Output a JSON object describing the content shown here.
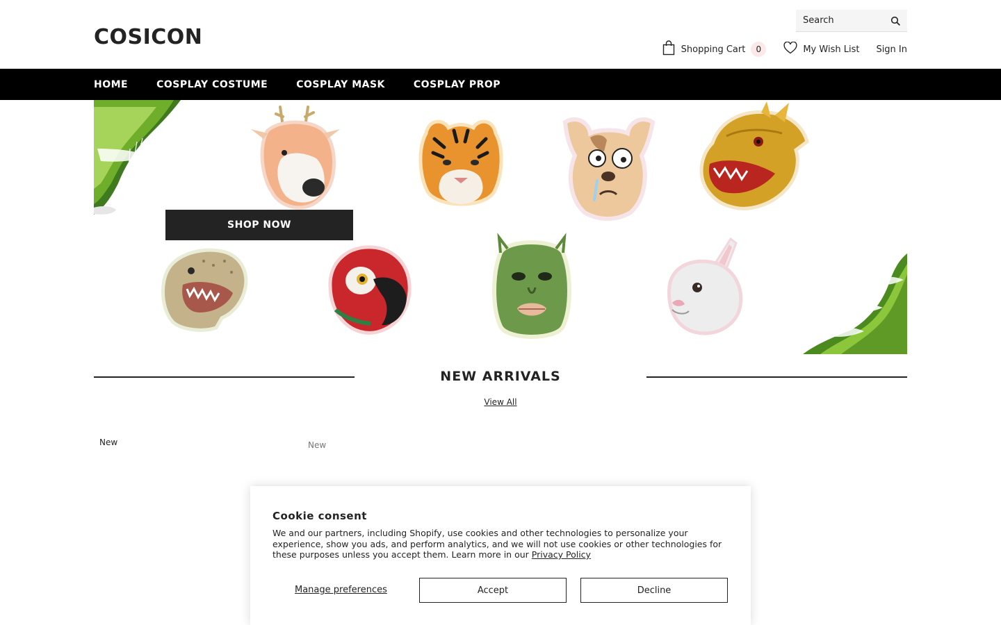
{
  "header": {
    "logo": "COSICON",
    "search_placeholder": "Search",
    "cart_label": "Shopping Cart",
    "cart_count": "0",
    "wishlist_label": "My Wish List",
    "signin_label": "Sign In"
  },
  "nav": {
    "items": [
      "HOME",
      "COSPLAY COSTUME",
      "COSPLAY MASK",
      "COSPLAY PROP"
    ]
  },
  "hero": {
    "cta": "SHOP NOW",
    "masks": [
      "deer",
      "tiger",
      "dog",
      "dragon",
      "dinosaur",
      "parrot",
      "fish-man",
      "rabbit"
    ]
  },
  "new_arrivals": {
    "title": "NEW ARRIVALS",
    "view_all": "View All",
    "badges": [
      "New",
      "New"
    ]
  },
  "cookie": {
    "title": "Cookie consent",
    "text": "We and our partners, including Shopify, use cookies and other technologies to personalize your experience, show you ads, and perform analytics, and we will not use cookies or other technologies for these purposes unless you accept them. Learn more in our ",
    "policy_link": "Privacy Policy",
    "manage": "Manage preferences",
    "accept": "Accept",
    "decline": "Decline"
  },
  "colors": {
    "brand_dark": "#232323",
    "nav_bg": "#000000",
    "cart_badge_bg": "#fbe9e9",
    "leaf_green": "#7ab52c"
  }
}
